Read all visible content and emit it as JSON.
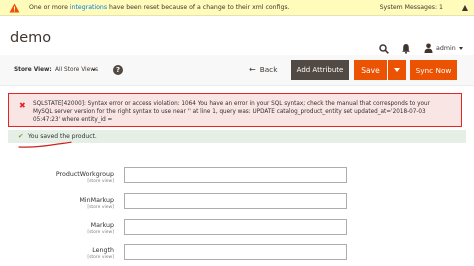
{
  "system_bar": {
    "message_pre": "One or more ",
    "message_link": "integrations",
    "message_post": " have been reset because of a change to their xml configs.",
    "system_messages": "System Messages: 1"
  },
  "header": {
    "title": "demo",
    "username": "admin"
  },
  "actions": {
    "store_view_label": "Store View:",
    "store_view_value": "All Store Views",
    "help_label": "?",
    "back_label": "Back",
    "add_attribute_label": "Add Attribute",
    "save_label": "Save",
    "sync_now_label": "Sync Now"
  },
  "messages": {
    "error_text": "SQLSTATE[42000]: Syntax error or access violation: 1064 You have an error in your SQL syntax; check the manual that corresponds to your MySQL server version for the right syntax to use near '' at line 1, query was: UPDATE catalog_product_entity set updated_at='2018-07-03 05:47:23' where entity_id =",
    "success_text": "You saved the product."
  },
  "fields": [
    {
      "label": "ProductWorkgroup",
      "scope": "[store view]",
      "value": ""
    },
    {
      "label": "MinMarkup",
      "scope": "[store view]",
      "value": ""
    },
    {
      "label": "Markup",
      "scope": "[store view]",
      "value": ""
    },
    {
      "label": "Length",
      "scope": "[store view]",
      "value": ""
    }
  ],
  "colors": {
    "accent": "#eb5202",
    "error": "#e22626",
    "success": "#79a22e",
    "dark_button": "#514943"
  },
  "icons": {
    "warning": "warning-icon",
    "search": "search-icon",
    "bell": "bell-icon",
    "user": "user-icon",
    "help": "help-icon",
    "back": "arrow-left-icon",
    "error": "error-x-icon",
    "success": "checkmark-icon"
  }
}
